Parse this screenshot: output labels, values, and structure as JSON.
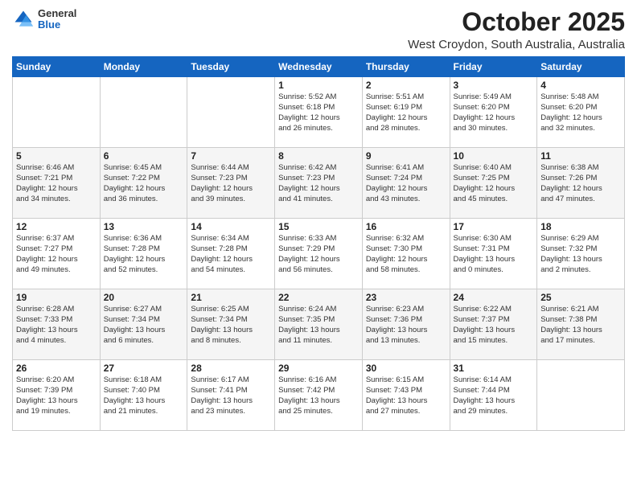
{
  "logo": {
    "general": "General",
    "blue": "Blue"
  },
  "header": {
    "month": "October 2025",
    "location": "West Croydon, South Australia, Australia"
  },
  "weekdays": [
    "Sunday",
    "Monday",
    "Tuesday",
    "Wednesday",
    "Thursday",
    "Friday",
    "Saturday"
  ],
  "weeks": [
    [
      {
        "day": "",
        "info": ""
      },
      {
        "day": "",
        "info": ""
      },
      {
        "day": "",
        "info": ""
      },
      {
        "day": "1",
        "info": "Sunrise: 5:52 AM\nSunset: 6:18 PM\nDaylight: 12 hours\nand 26 minutes."
      },
      {
        "day": "2",
        "info": "Sunrise: 5:51 AM\nSunset: 6:19 PM\nDaylight: 12 hours\nand 28 minutes."
      },
      {
        "day": "3",
        "info": "Sunrise: 5:49 AM\nSunset: 6:20 PM\nDaylight: 12 hours\nand 30 minutes."
      },
      {
        "day": "4",
        "info": "Sunrise: 5:48 AM\nSunset: 6:20 PM\nDaylight: 12 hours\nand 32 minutes."
      }
    ],
    [
      {
        "day": "5",
        "info": "Sunrise: 6:46 AM\nSunset: 7:21 PM\nDaylight: 12 hours\nand 34 minutes."
      },
      {
        "day": "6",
        "info": "Sunrise: 6:45 AM\nSunset: 7:22 PM\nDaylight: 12 hours\nand 36 minutes."
      },
      {
        "day": "7",
        "info": "Sunrise: 6:44 AM\nSunset: 7:23 PM\nDaylight: 12 hours\nand 39 minutes."
      },
      {
        "day": "8",
        "info": "Sunrise: 6:42 AM\nSunset: 7:23 PM\nDaylight: 12 hours\nand 41 minutes."
      },
      {
        "day": "9",
        "info": "Sunrise: 6:41 AM\nSunset: 7:24 PM\nDaylight: 12 hours\nand 43 minutes."
      },
      {
        "day": "10",
        "info": "Sunrise: 6:40 AM\nSunset: 7:25 PM\nDaylight: 12 hours\nand 45 minutes."
      },
      {
        "day": "11",
        "info": "Sunrise: 6:38 AM\nSunset: 7:26 PM\nDaylight: 12 hours\nand 47 minutes."
      }
    ],
    [
      {
        "day": "12",
        "info": "Sunrise: 6:37 AM\nSunset: 7:27 PM\nDaylight: 12 hours\nand 49 minutes."
      },
      {
        "day": "13",
        "info": "Sunrise: 6:36 AM\nSunset: 7:28 PM\nDaylight: 12 hours\nand 52 minutes."
      },
      {
        "day": "14",
        "info": "Sunrise: 6:34 AM\nSunset: 7:28 PM\nDaylight: 12 hours\nand 54 minutes."
      },
      {
        "day": "15",
        "info": "Sunrise: 6:33 AM\nSunset: 7:29 PM\nDaylight: 12 hours\nand 56 minutes."
      },
      {
        "day": "16",
        "info": "Sunrise: 6:32 AM\nSunset: 7:30 PM\nDaylight: 12 hours\nand 58 minutes."
      },
      {
        "day": "17",
        "info": "Sunrise: 6:30 AM\nSunset: 7:31 PM\nDaylight: 13 hours\nand 0 minutes."
      },
      {
        "day": "18",
        "info": "Sunrise: 6:29 AM\nSunset: 7:32 PM\nDaylight: 13 hours\nand 2 minutes."
      }
    ],
    [
      {
        "day": "19",
        "info": "Sunrise: 6:28 AM\nSunset: 7:33 PM\nDaylight: 13 hours\nand 4 minutes."
      },
      {
        "day": "20",
        "info": "Sunrise: 6:27 AM\nSunset: 7:34 PM\nDaylight: 13 hours\nand 6 minutes."
      },
      {
        "day": "21",
        "info": "Sunrise: 6:25 AM\nSunset: 7:34 PM\nDaylight: 13 hours\nand 8 minutes."
      },
      {
        "day": "22",
        "info": "Sunrise: 6:24 AM\nSunset: 7:35 PM\nDaylight: 13 hours\nand 11 minutes."
      },
      {
        "day": "23",
        "info": "Sunrise: 6:23 AM\nSunset: 7:36 PM\nDaylight: 13 hours\nand 13 minutes."
      },
      {
        "day": "24",
        "info": "Sunrise: 6:22 AM\nSunset: 7:37 PM\nDaylight: 13 hours\nand 15 minutes."
      },
      {
        "day": "25",
        "info": "Sunrise: 6:21 AM\nSunset: 7:38 PM\nDaylight: 13 hours\nand 17 minutes."
      }
    ],
    [
      {
        "day": "26",
        "info": "Sunrise: 6:20 AM\nSunset: 7:39 PM\nDaylight: 13 hours\nand 19 minutes."
      },
      {
        "day": "27",
        "info": "Sunrise: 6:18 AM\nSunset: 7:40 PM\nDaylight: 13 hours\nand 21 minutes."
      },
      {
        "day": "28",
        "info": "Sunrise: 6:17 AM\nSunset: 7:41 PM\nDaylight: 13 hours\nand 23 minutes."
      },
      {
        "day": "29",
        "info": "Sunrise: 6:16 AM\nSunset: 7:42 PM\nDaylight: 13 hours\nand 25 minutes."
      },
      {
        "day": "30",
        "info": "Sunrise: 6:15 AM\nSunset: 7:43 PM\nDaylight: 13 hours\nand 27 minutes."
      },
      {
        "day": "31",
        "info": "Sunrise: 6:14 AM\nSunset: 7:44 PM\nDaylight: 13 hours\nand 29 minutes."
      },
      {
        "day": "",
        "info": ""
      }
    ]
  ]
}
